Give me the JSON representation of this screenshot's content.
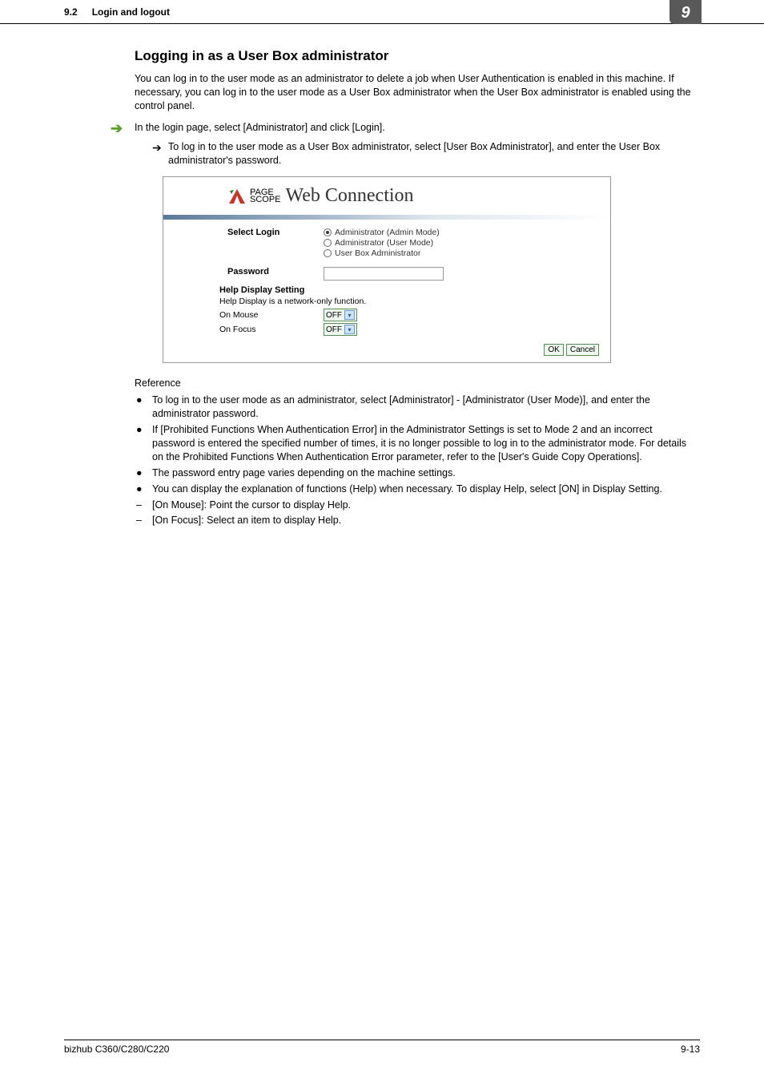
{
  "header": {
    "section": "9.2",
    "title": "Login and logout",
    "chapter": "9"
  },
  "h2": "Logging in as a User Box administrator",
  "intro": "You can log in to the user mode as an administrator to delete a job when User Authentication is enabled in this machine. If necessary, you can log in to the user mode as a User Box administrator when the User Box administrator is enabled using the control panel.",
  "step1": "In the login page, select [Administrator] and click [Login].",
  "step1sub": "To log in to the user mode as a User Box administrator, select [User Box Administrator], and enter the User Box administrator's password.",
  "screenshot": {
    "logo_page": "PAGE",
    "logo_scope": "SCOPE",
    "logo_web": "Web Connection",
    "select_login_label": "Select Login",
    "radio1": "Administrator (Admin Mode)",
    "radio2": "Administrator (User Mode)",
    "radio3": "User Box Administrator",
    "password_label": "Password",
    "help_title": "Help Display Setting",
    "help_note": "Help Display is a network-only function.",
    "on_mouse_label": "On Mouse",
    "on_focus_label": "On Focus",
    "off_value": "OFF",
    "ok_btn": "OK",
    "cancel_btn": "Cancel"
  },
  "reference_label": "Reference",
  "refs": [
    "To log in to the user mode as an administrator, select [Administrator] - [Administrator (User Mode)], and enter the administrator password.",
    "If [Prohibited Functions When Authentication Error] in the Administrator Settings is set to Mode 2 and an incorrect password is entered the specified number of times, it is no longer possible to log in to the administrator mode. For details on the Prohibited Functions When Authentication Error parameter, refer to the [User's Guide Copy Operations].",
    "The password entry page varies depending on the machine settings.",
    "You can display the explanation of functions (Help) when necessary. To display Help, select [ON] in Display Setting."
  ],
  "subrefs": [
    "[On Mouse]: Point the cursor to display Help.",
    "[On Focus]: Select an item to display Help."
  ],
  "footer": {
    "left": "bizhub C360/C280/C220",
    "right": "9-13"
  }
}
